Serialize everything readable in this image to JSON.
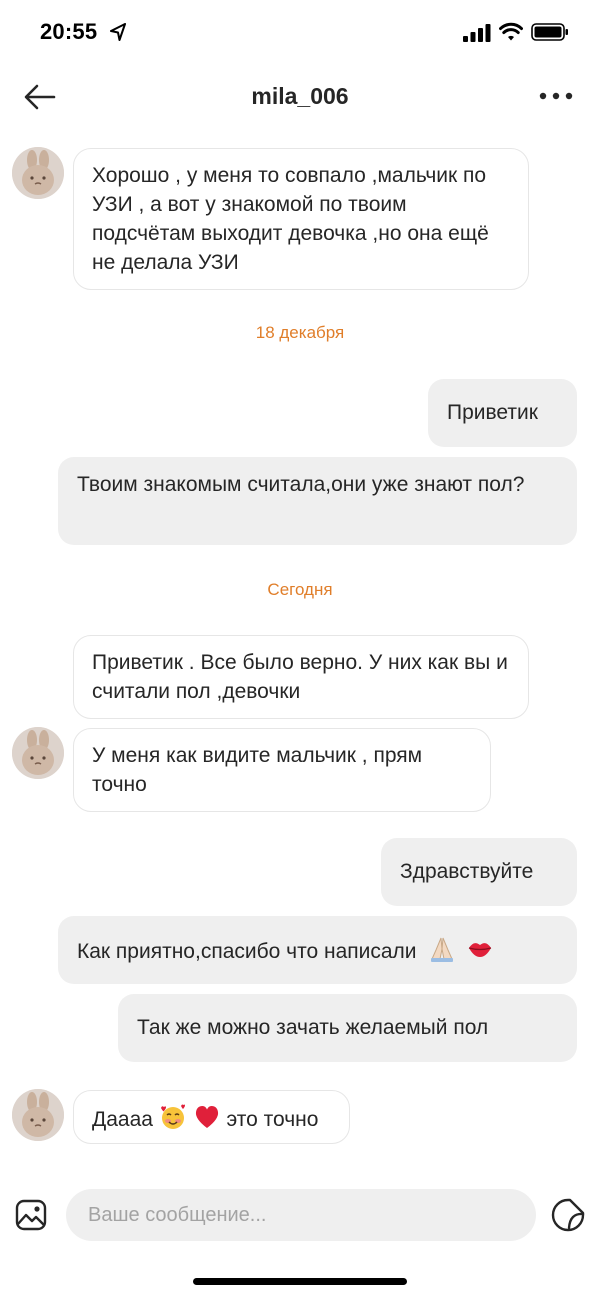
{
  "status_bar": {
    "time": "20:55"
  },
  "header": {
    "title": "mila_006"
  },
  "dates": {
    "first": "18 декабря",
    "second": "Сегодня"
  },
  "messages": [
    {
      "from": "them",
      "text": "Хорошо , у меня то совпало ,мальчик по УЗИ , а вот у знакомой по твоим подсчётам выходит девочка ,но она ещё не делала УЗИ"
    },
    {
      "from": "me",
      "text": "Приветик"
    },
    {
      "from": "me",
      "text": "Твоим знакомым считала,они уже знают пол?"
    },
    {
      "from": "them",
      "text": "Приветик . Все было верно. У них как вы и считали пол ,девочки"
    },
    {
      "from": "them",
      "text": "У меня как видите мальчик , прям точно"
    },
    {
      "from": "me",
      "text": "Здравствуйте"
    },
    {
      "from": "me",
      "text": "Как приятно,спасибо что написали"
    },
    {
      "from": "me",
      "text": "Так же можно зачать желаемый пол"
    },
    {
      "from": "them",
      "text": "Даааа",
      "text_after": "это точно"
    }
  ],
  "composer": {
    "placeholder": "Ваше сообщение..."
  },
  "colors": {
    "date_separator": "#e07e2a",
    "outgoing_bubble": "#efefef",
    "incoming_border": "#e6e6e6"
  }
}
